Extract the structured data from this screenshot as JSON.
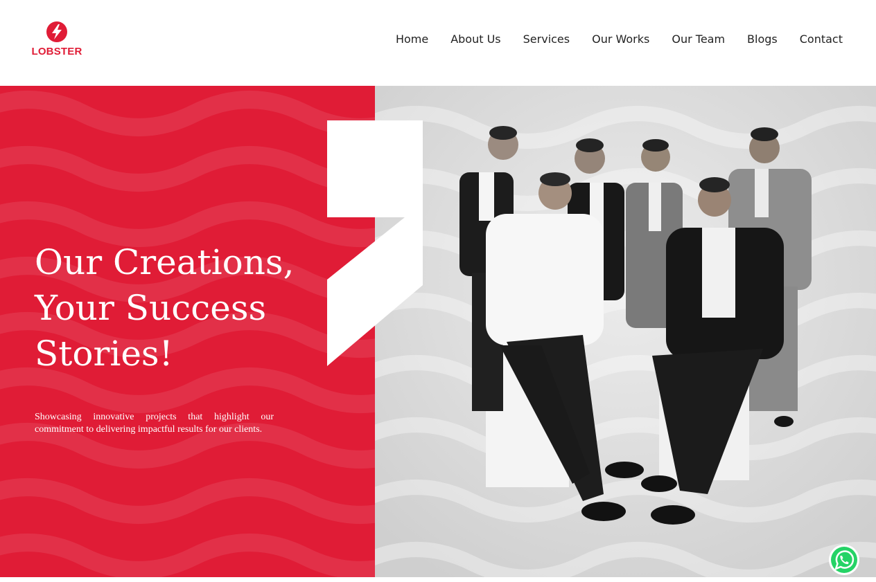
{
  "brand": {
    "name": "LOBSTER",
    "color": "#e01c36"
  },
  "nav": {
    "items": [
      {
        "label": "Home"
      },
      {
        "label": "About Us"
      },
      {
        "label": "Services"
      },
      {
        "label": "Our Works"
      },
      {
        "label": "Our Team"
      },
      {
        "label": "Blogs"
      },
      {
        "label": "Contact"
      }
    ]
  },
  "hero": {
    "headline_lines": [
      "Our Creations,",
      "Your Success",
      "Stories!"
    ],
    "subtext": "Showcasing innovative projects that highlight our commitment to delivering impactful results for our clients.",
    "photo_description_icon": "team-photo"
  },
  "floating": {
    "icon": "whatsapp-icon",
    "color": "#25d366"
  }
}
